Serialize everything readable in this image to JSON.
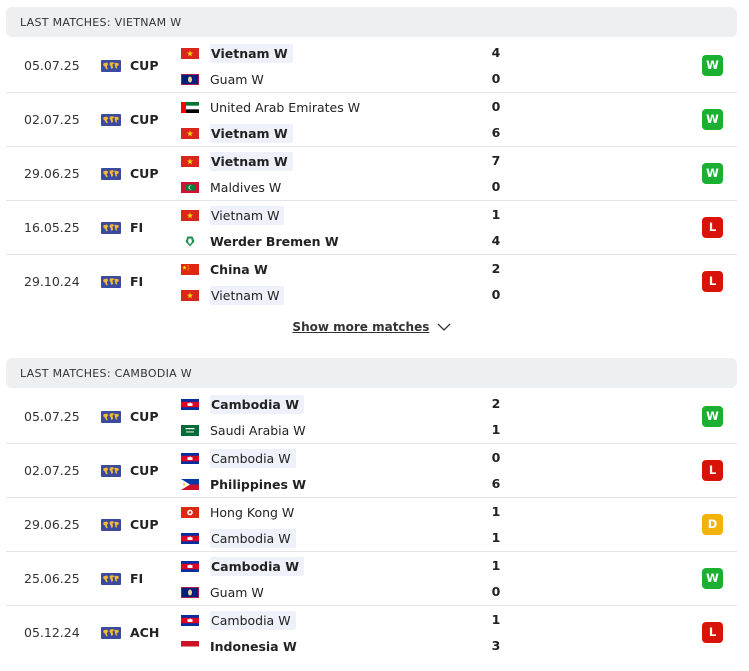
{
  "sections": [
    {
      "title": "LAST MATCHES: VIETNAM W",
      "matches": [
        {
          "date": "05.07.25",
          "comp": "CUP",
          "home": {
            "name": "Vietnam W",
            "flag": "vietnam",
            "win": true,
            "hl": true
          },
          "away": {
            "name": "Guam W",
            "flag": "guam",
            "win": false,
            "hl": false
          },
          "score_home": "4",
          "score_away": "0",
          "result": "W"
        },
        {
          "date": "02.07.25",
          "comp": "CUP",
          "home": {
            "name": "United Arab Emirates W",
            "flag": "uae",
            "win": false,
            "hl": false
          },
          "away": {
            "name": "Vietnam W",
            "flag": "vietnam",
            "win": true,
            "hl": true
          },
          "score_home": "0",
          "score_away": "6",
          "result": "W"
        },
        {
          "date": "29.06.25",
          "comp": "CUP",
          "home": {
            "name": "Vietnam W",
            "flag": "vietnam",
            "win": true,
            "hl": true
          },
          "away": {
            "name": "Maldives W",
            "flag": "maldives",
            "win": false,
            "hl": false
          },
          "score_home": "7",
          "score_away": "0",
          "result": "W"
        },
        {
          "date": "16.05.25",
          "comp": "FI",
          "home": {
            "name": "Vietnam W",
            "flag": "vietnam",
            "win": false,
            "hl": true
          },
          "away": {
            "name": "Werder Bremen W",
            "flag": "werder",
            "win": true,
            "hl": false
          },
          "score_home": "1",
          "score_away": "4",
          "result": "L"
        },
        {
          "date": "29.10.24",
          "comp": "FI",
          "home": {
            "name": "China W",
            "flag": "china",
            "win": true,
            "hl": false
          },
          "away": {
            "name": "Vietnam W",
            "flag": "vietnam",
            "win": false,
            "hl": true
          },
          "score_home": "2",
          "score_away": "0",
          "result": "L"
        }
      ],
      "show_more": "Show more matches"
    },
    {
      "title": "LAST MATCHES: CAMBODIA W",
      "matches": [
        {
          "date": "05.07.25",
          "comp": "CUP",
          "home": {
            "name": "Cambodia W",
            "flag": "cambodia",
            "win": true,
            "hl": true
          },
          "away": {
            "name": "Saudi Arabia W",
            "flag": "saudi",
            "win": false,
            "hl": false
          },
          "score_home": "2",
          "score_away": "1",
          "result": "W"
        },
        {
          "date": "02.07.25",
          "comp": "CUP",
          "home": {
            "name": "Cambodia W",
            "flag": "cambodia",
            "win": false,
            "hl": true
          },
          "away": {
            "name": "Philippines W",
            "flag": "philippines",
            "win": true,
            "hl": false
          },
          "score_home": "0",
          "score_away": "6",
          "result": "L"
        },
        {
          "date": "29.06.25",
          "comp": "CUP",
          "home": {
            "name": "Hong Kong W",
            "flag": "hongkong",
            "win": false,
            "hl": false
          },
          "away": {
            "name": "Cambodia W",
            "flag": "cambodia",
            "win": false,
            "hl": true
          },
          "score_home": "1",
          "score_away": "1",
          "result": "D"
        },
        {
          "date": "25.06.25",
          "comp": "FI",
          "home": {
            "name": "Cambodia W",
            "flag": "cambodia",
            "win": true,
            "hl": true
          },
          "away": {
            "name": "Guam W",
            "flag": "guam",
            "win": false,
            "hl": false
          },
          "score_home": "1",
          "score_away": "0",
          "result": "W"
        },
        {
          "date": "05.12.24",
          "comp": "ACH",
          "home": {
            "name": "Cambodia W",
            "flag": "cambodia",
            "win": false,
            "hl": true
          },
          "away": {
            "name": "Indonesia W",
            "flag": "indonesia",
            "win": true,
            "hl": false
          },
          "score_home": "1",
          "score_away": "3",
          "result": "L"
        }
      ]
    }
  ],
  "colors": {
    "win": "#1bb032",
    "loss": "#d9120a",
    "draw": "#f2b20c",
    "header_bg": "#eeff1",
    "highlight": "#eef1f9"
  },
  "icons": {
    "competition": "world-map-icon",
    "show_more": "chevron-down-icon"
  }
}
